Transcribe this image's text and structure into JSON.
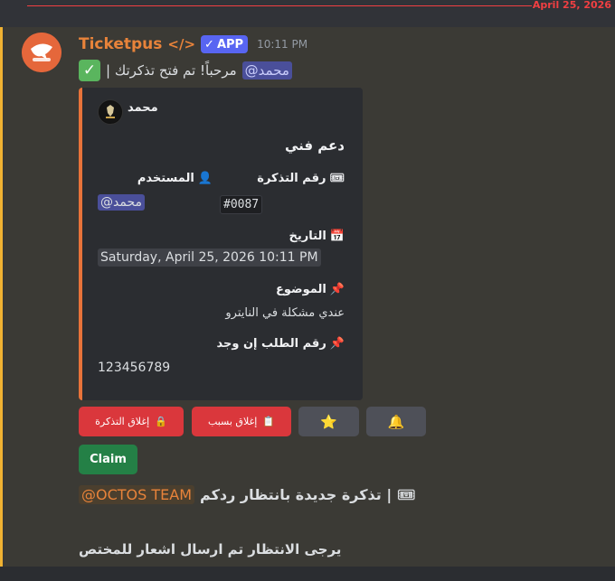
{
  "divider": {
    "date": "April 25, 2026"
  },
  "message": {
    "username": "Ticketpus",
    "code_icon": "</>",
    "app_badge": "APP",
    "timestamp": "10:11 PM",
    "content_mention": "@محمد",
    "content_text": "| مرحباً! تم فتح تذكرتك",
    "avatar_icon": "bot-avatar-icon"
  },
  "embed": {
    "accent_color": "#e8733a",
    "author_name": "محمد",
    "title": "دعم فني",
    "fields": {
      "ticket_number": {
        "name": "رقم التذكرة",
        "icon": "🎟",
        "value": "#0087"
      },
      "user": {
        "name": "المستخدم",
        "icon": "👤",
        "value": "@محمد"
      },
      "date": {
        "name": "التاريخ",
        "icon": "📅",
        "value": "Saturday, April 25, 2026 10:11 PM"
      },
      "subject": {
        "name": "الموضوع",
        "icon": "📌",
        "value": "عندي مشكلة في النايترو"
      },
      "order_number": {
        "name": "رقم الطلب إن وجد",
        "icon": "📌",
        "value": "123456789"
      }
    }
  },
  "buttons": {
    "close_ticket": {
      "label": "إغلاق التذكرة",
      "icon": "🔒"
    },
    "close_reason": {
      "label": "إغلاق بسبب",
      "icon": "📋"
    },
    "star": {
      "icon": "⭐"
    },
    "bell": {
      "icon": "🔔"
    },
    "claim": {
      "label": "Claim"
    }
  },
  "followup": {
    "icon": "🎟",
    "text": "تذكرة جديدة بانتظار ردكم |",
    "mention": "@OCTOS TEAM",
    "notice": "يرجى الانتظار تم ارسال اشعار للمختص"
  }
}
